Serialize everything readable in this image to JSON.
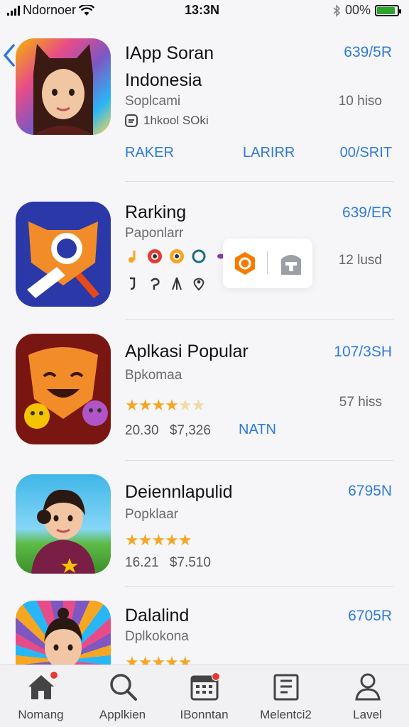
{
  "status_bar": {
    "carrier": "Ndornoer",
    "time": "13:3Ν",
    "battery": "00%",
    "battery_level": 0.9,
    "bluetooth_icon": "bluetooth-icon",
    "wifi_icon": "wifi-icon"
  },
  "apps": [
    {
      "title_line1": "IApp Soran",
      "title_line2": "Indonesia",
      "subtitle": "Soplcami",
      "price": "639/5R",
      "size": "10 hiso",
      "developer": "1hkool SOki",
      "links": [
        "RAKER",
        "LARIRR",
        "00/SRIT"
      ]
    },
    {
      "title": "Rarking",
      "subtitle": "Paponlarr",
      "price": "639/ER",
      "size": "12 lusd"
    },
    {
      "title": "Aplkasi Popular",
      "subtitle": "Bpkomaa",
      "price": "107/3SH",
      "size": "57 hiss",
      "rating": 3.5,
      "meta": [
        "20.30",
        "$7,326"
      ],
      "link": "NATN"
    },
    {
      "title": "Deiennlapulid",
      "subtitle": "Popklaar",
      "price": "6795N",
      "rating": 5,
      "meta": [
        "16.21",
        "$7.510"
      ]
    },
    {
      "title": "Dalalind",
      "subtitle": "Dplkokona",
      "price": "6705R"
    }
  ],
  "tabs": [
    {
      "label": "Nomang",
      "icon": "home-icon",
      "badge": true
    },
    {
      "label": "Applkien",
      "icon": "search-icon",
      "badge": false
    },
    {
      "label": "IBonntan",
      "icon": "calendar-icon",
      "badge": true
    },
    {
      "label": "Melentci2",
      "icon": "document-icon",
      "badge": false
    },
    {
      "label": "Lavel",
      "icon": "person-icon",
      "badge": false
    }
  ],
  "colors": {
    "accent": "#2f7ad8",
    "star": "#f5a623",
    "badge": "#e53935"
  }
}
